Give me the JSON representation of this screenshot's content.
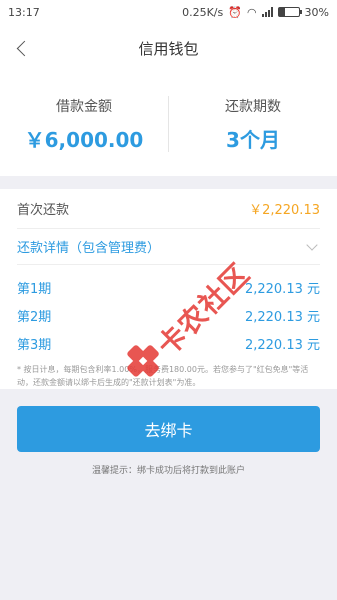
{
  "status_bar": {
    "time": "13:17",
    "network_speed": "0.25K/s",
    "battery": "30%",
    "battery_level": 0.3,
    "icons": [
      "alarm-icon",
      "wifi-icon",
      "signal-icon",
      "battery-icon"
    ]
  },
  "nav": {
    "title": "信用钱包",
    "back_icon": "chevron-left-icon"
  },
  "summary": {
    "amount_label": "借款金额",
    "amount_value": "￥6,000.00",
    "period_label": "还款期数",
    "period_value": "3个月"
  },
  "details": {
    "first_label": "首次还款",
    "first_amount": "￥2,220.13",
    "toggle_label": "还款详情（包含管理费）",
    "periods": [
      {
        "label": "第1期",
        "amount": "2,220.13 元"
      },
      {
        "label": "第2期",
        "amount": "2,220.13 元"
      },
      {
        "label": "第3期",
        "amount": "2,220.13 元"
      }
    ],
    "note": "* 按日计息，每期包含利率1.00%，服务费180.00元。若您参与了\"红包免息\"等活动，还款金额请以绑卡后生成的\"还款计划表\"为准。"
  },
  "action": {
    "bind_card_label": "去绑卡"
  },
  "tip": "温馨提示：绑卡成功后将打款到此账户",
  "watermark": {
    "text": "卡农社区",
    "color": "#e53935"
  },
  "colors": {
    "accent": "#2d9be0",
    "highlight": "#f5a623",
    "background": "#efeff4"
  }
}
